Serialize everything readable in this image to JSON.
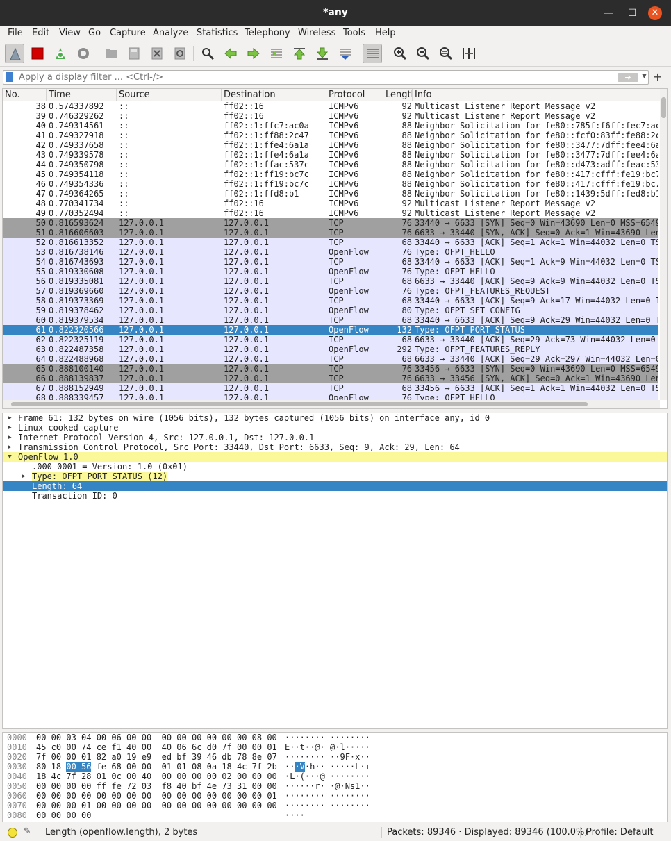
{
  "window": {
    "title": "*any"
  },
  "menu": [
    "File",
    "Edit",
    "View",
    "Go",
    "Capture",
    "Analyze",
    "Statistics",
    "Telephony",
    "Wireless",
    "Tools",
    "Help"
  ],
  "filter": {
    "placeholder": "Apply a display filter ... <Ctrl-/>",
    "value": ""
  },
  "columns": [
    "No.",
    "Time",
    "Source",
    "Destination",
    "Protocol",
    "Length",
    "Info"
  ],
  "packets": [
    {
      "no": "38",
      "time": "0.574337892",
      "src": "::",
      "dst": "ff02::16",
      "proto": "ICMPv6",
      "len": "92",
      "info": "Multicast Listener Report Message v2",
      "style": "icmp"
    },
    {
      "no": "39",
      "time": "0.746329262",
      "src": "::",
      "dst": "ff02::16",
      "proto": "ICMPv6",
      "len": "92",
      "info": "Multicast Listener Report Message v2",
      "style": "icmp"
    },
    {
      "no": "40",
      "time": "0.749314561",
      "src": "::",
      "dst": "ff02::1:ffc7:ac0a",
      "proto": "ICMPv6",
      "len": "88",
      "info": "Neighbor Solicitation for fe80::785f:f6ff:fec7:ac",
      "style": "icmp"
    },
    {
      "no": "41",
      "time": "0.749327918",
      "src": "::",
      "dst": "ff02::1:ff88:2c47",
      "proto": "ICMPv6",
      "len": "88",
      "info": "Neighbor Solicitation for fe80::fcf0:83ff:fe88:2c",
      "style": "icmp"
    },
    {
      "no": "42",
      "time": "0.749337658",
      "src": "::",
      "dst": "ff02::1:ffe4:6a1a",
      "proto": "ICMPv6",
      "len": "88",
      "info": "Neighbor Solicitation for fe80::3477:7dff:fee4:6a",
      "style": "icmp"
    },
    {
      "no": "43",
      "time": "0.749339578",
      "src": "::",
      "dst": "ff02::1:ffe4:6a1a",
      "proto": "ICMPv6",
      "len": "88",
      "info": "Neighbor Solicitation for fe80::3477:7dff:fee4:6a",
      "style": "icmp"
    },
    {
      "no": "44",
      "time": "0.749350798",
      "src": "::",
      "dst": "ff02::1:ffac:537c",
      "proto": "ICMPv6",
      "len": "88",
      "info": "Neighbor Solicitation for fe80::d473:adff:feac:53",
      "style": "icmp"
    },
    {
      "no": "45",
      "time": "0.749354118",
      "src": "::",
      "dst": "ff02::1:ff19:bc7c",
      "proto": "ICMPv6",
      "len": "88",
      "info": "Neighbor Solicitation for fe80::417:cfff:fe19:bc7",
      "style": "icmp"
    },
    {
      "no": "46",
      "time": "0.749354336",
      "src": "::",
      "dst": "ff02::1:ff19:bc7c",
      "proto": "ICMPv6",
      "len": "88",
      "info": "Neighbor Solicitation for fe80::417:cfff:fe19:bc7",
      "style": "icmp"
    },
    {
      "no": "47",
      "time": "0.749364265",
      "src": "::",
      "dst": "ff02::1:ffd8:b1",
      "proto": "ICMPv6",
      "len": "88",
      "info": "Neighbor Solicitation for fe80::1439:5dff:fed8:b1",
      "style": "icmp"
    },
    {
      "no": "48",
      "time": "0.770341734",
      "src": "::",
      "dst": "ff02::16",
      "proto": "ICMPv6",
      "len": "92",
      "info": "Multicast Listener Report Message v2",
      "style": "icmp"
    },
    {
      "no": "49",
      "time": "0.770352494",
      "src": "::",
      "dst": "ff02::16",
      "proto": "ICMPv6",
      "len": "92",
      "info": "Multicast Listener Report Message v2",
      "style": "icmp"
    },
    {
      "no": "50",
      "time": "0.816593624",
      "src": "127.0.0.1",
      "dst": "127.0.0.1",
      "proto": "TCP",
      "len": "76",
      "info": "33440 → 6633 [SYN] Seq=0 Win=43690 Len=0 MSS=6549",
      "style": "syn"
    },
    {
      "no": "51",
      "time": "0.816606603",
      "src": "127.0.0.1",
      "dst": "127.0.0.1",
      "proto": "TCP",
      "len": "76",
      "info": "6633 → 33440 [SYN, ACK] Seq=0 Ack=1 Win=43690 Len",
      "style": "syn"
    },
    {
      "no": "52",
      "time": "0.816613352",
      "src": "127.0.0.1",
      "dst": "127.0.0.1",
      "proto": "TCP",
      "len": "68",
      "info": "33440 → 6633 [ACK] Seq=1 Ack=1 Win=44032 Len=0 TS",
      "style": "tcp"
    },
    {
      "no": "53",
      "time": "0.816738146",
      "src": "127.0.0.1",
      "dst": "127.0.0.1",
      "proto": "OpenFlow",
      "len": "76",
      "info": "Type: OFPT_HELLO",
      "style": "tcp"
    },
    {
      "no": "54",
      "time": "0.816743693",
      "src": "127.0.0.1",
      "dst": "127.0.0.1",
      "proto": "TCP",
      "len": "68",
      "info": "33440 → 6633 [ACK] Seq=1 Ack=9 Win=44032 Len=0 TS",
      "style": "tcp"
    },
    {
      "no": "55",
      "time": "0.819330608",
      "src": "127.0.0.1",
      "dst": "127.0.0.1",
      "proto": "OpenFlow",
      "len": "76",
      "info": "Type: OFPT_HELLO",
      "style": "tcp"
    },
    {
      "no": "56",
      "time": "0.819335081",
      "src": "127.0.0.1",
      "dst": "127.0.0.1",
      "proto": "TCP",
      "len": "68",
      "info": "6633 → 33440 [ACK] Seq=9 Ack=9 Win=44032 Len=0 TS",
      "style": "tcp"
    },
    {
      "no": "57",
      "time": "0.819369660",
      "src": "127.0.0.1",
      "dst": "127.0.0.1",
      "proto": "OpenFlow",
      "len": "76",
      "info": "Type: OFPT_FEATURES_REQUEST",
      "style": "tcp"
    },
    {
      "no": "58",
      "time": "0.819373369",
      "src": "127.0.0.1",
      "dst": "127.0.0.1",
      "proto": "TCP",
      "len": "68",
      "info": "33440 → 6633 [ACK] Seq=9 Ack=17 Win=44032 Len=0 T",
      "style": "tcp"
    },
    {
      "no": "59",
      "time": "0.819378462",
      "src": "127.0.0.1",
      "dst": "127.0.0.1",
      "proto": "OpenFlow",
      "len": "80",
      "info": "Type: OFPT_SET_CONFIG",
      "style": "tcp"
    },
    {
      "no": "60",
      "time": "0.819379534",
      "src": "127.0.0.1",
      "dst": "127.0.0.1",
      "proto": "TCP",
      "len": "68",
      "info": "33440 → 6633 [ACK] Seq=9 Ack=29 Win=44032 Len=0 T",
      "style": "tcp"
    },
    {
      "no": "61",
      "time": "0.822320566",
      "src": "127.0.0.1",
      "dst": "127.0.0.1",
      "proto": "OpenFlow",
      "len": "132",
      "info": "Type: OFPT_PORT_STATUS",
      "style": "sel"
    },
    {
      "no": "62",
      "time": "0.822325119",
      "src": "127.0.0.1",
      "dst": "127.0.0.1",
      "proto": "TCP",
      "len": "68",
      "info": "6633 → 33440 [ACK] Seq=29 Ack=73 Win=44032 Len=0",
      "style": "tcp"
    },
    {
      "no": "63",
      "time": "0.822487358",
      "src": "127.0.0.1",
      "dst": "127.0.0.1",
      "proto": "OpenFlow",
      "len": "292",
      "info": "Type: OFPT_FEATURES_REPLY",
      "style": "tcp"
    },
    {
      "no": "64",
      "time": "0.822488968",
      "src": "127.0.0.1",
      "dst": "127.0.0.1",
      "proto": "TCP",
      "len": "68",
      "info": "6633 → 33440 [ACK] Seq=29 Ack=297 Win=44032 Len=0",
      "style": "tcp"
    },
    {
      "no": "65",
      "time": "0.888100140",
      "src": "127.0.0.1",
      "dst": "127.0.0.1",
      "proto": "TCP",
      "len": "76",
      "info": "33456 → 6633 [SYN] Seq=0 Win=43690 Len=0 MSS=6549",
      "style": "syn"
    },
    {
      "no": "66",
      "time": "0.888139837",
      "src": "127.0.0.1",
      "dst": "127.0.0.1",
      "proto": "TCP",
      "len": "76",
      "info": "6633 → 33456 [SYN, ACK] Seq=0 Ack=1 Win=43690 Len",
      "style": "syn"
    },
    {
      "no": "67",
      "time": "0.888152949",
      "src": "127.0.0.1",
      "dst": "127.0.0.1",
      "proto": "TCP",
      "len": "68",
      "info": "33456 → 6633 [ACK] Seq=1 Ack=1 Win=44032 Len=0 TS",
      "style": "tcp"
    },
    {
      "no": "68",
      "time": "0.888339457",
      "src": "127.0.0.1",
      "dst": "127.0.0.1",
      "proto": "OpenFlow",
      "len": "76",
      "info": "Type: OFPT_HELLO",
      "style": "tcp"
    }
  ],
  "details": [
    {
      "arrow": "right",
      "level": 0,
      "text": "Frame 61: 132 bytes on wire (1056 bits), 132 bytes captured (1056 bits) on interface any, id 0",
      "style": ""
    },
    {
      "arrow": "right",
      "level": 0,
      "text": "Linux cooked capture",
      "style": ""
    },
    {
      "arrow": "right",
      "level": 0,
      "text": "Internet Protocol Version 4, Src: 127.0.0.1, Dst: 127.0.0.1",
      "style": ""
    },
    {
      "arrow": "right",
      "level": 0,
      "text": "Transmission Control Protocol, Src Port: 33440, Dst Port: 6633, Seq: 9, Ack: 29, Len: 64",
      "style": ""
    },
    {
      "arrow": "down",
      "level": 0,
      "text": "OpenFlow 1.0",
      "style": "yellow"
    },
    {
      "arrow": "",
      "level": 1,
      "text": ".000 0001 = Version: 1.0 (0x01)",
      "style": ""
    },
    {
      "arrow": "right",
      "level": 1,
      "text": "Type: OFPT_PORT_STATUS (12)",
      "style": "yellow-text"
    },
    {
      "arrow": "",
      "level": 1,
      "text": "Length: 64",
      "style": "sel"
    },
    {
      "arrow": "",
      "level": 1,
      "text": "Transaction ID: 0",
      "style": ""
    }
  ],
  "bytes": [
    {
      "offset": "0000",
      "hex": "00 00 03 04 00 06 00 00  00 00 00 00 00 00 08 00",
      "ascii": "········ ········"
    },
    {
      "offset": "0010",
      "hex": "45 c0 00 74 ce f1 40 00  40 06 6c d0 7f 00 00 01",
      "ascii": "E··t··@· @·l·····"
    },
    {
      "offset": "0020",
      "hex": "7f 00 00 01 82 a0 19 e9  ed bf 39 46 db 78 8e 07",
      "ascii": "········ ··9F·x··"
    },
    {
      "offset": "0030",
      "hex_pre": "80 18 ",
      "hex_hl": "00 56",
      "hex_post": " fe 68 00 00  01 01 08 0a 18 4c 7f 2b",
      "ascii_pre": "··",
      "ascii_hl": "·V",
      "ascii_post": "·h·· ·····L·+"
    },
    {
      "offset": "0040",
      "hex": "18 4c 7f 28 01 0c 00 40  00 00 00 00 02 00 00 00",
      "ascii": "·L·(···@ ········"
    },
    {
      "offset": "0050",
      "hex": "00 00 00 00 ff fe 72 03  f8 40 bf 4e 73 31 00 00",
      "ascii": "······r· ·@·Ns1··"
    },
    {
      "offset": "0060",
      "hex": "00 00 00 00 00 00 00 00  00 00 00 00 00 00 00 01",
      "ascii": "········ ········"
    },
    {
      "offset": "0070",
      "hex": "00 00 00 01 00 00 00 00  00 00 00 00 00 00 00 00",
      "ascii": "········ ········"
    },
    {
      "offset": "0080",
      "hex": "00 00 00 00",
      "ascii": "····"
    }
  ],
  "status": {
    "field_info": "Length (openflow.length), 2 bytes",
    "packets": "Packets: 89346 · Displayed: 89346 (100.0%)",
    "profile": "Profile: Default"
  },
  "colors": {
    "selection": "#3584c4",
    "tcp_row": "#e7e6ff",
    "syn_row": "#a0a0a0",
    "highlight": "#fbf89a"
  }
}
